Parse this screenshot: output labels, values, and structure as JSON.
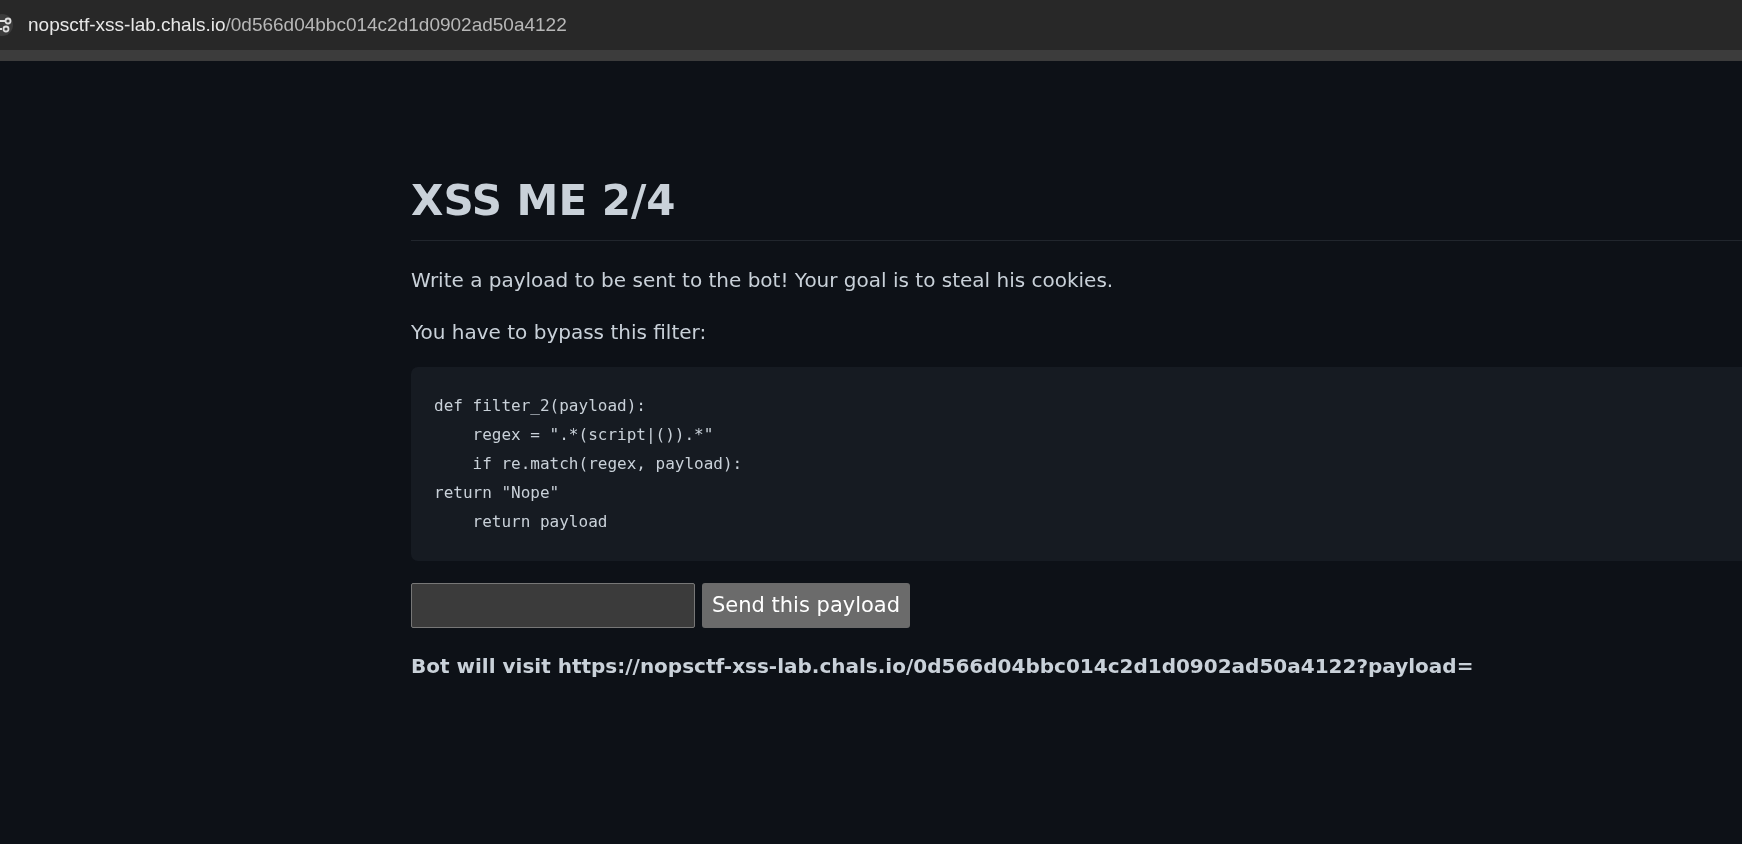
{
  "address_bar": {
    "domain": "nopsctf-xss-lab.chals.io",
    "path": "/0d566d04bbc014c2d1d0902ad50a4122"
  },
  "page": {
    "title": "XSS ME 2/4",
    "paragraphs": [
      "Write a payload to be sent to the bot! Your goal is to steal his cookies.",
      "You have to bypass this filter:"
    ],
    "code_lines": [
      "def filter_2(payload):",
      "    regex = \".*(script|()).*\"",
      "    if re.match(regex, payload):",
      "return \"Nope\"",
      "    return payload"
    ],
    "send_button": "Send this payload",
    "bot_note": "Bot will visit https://nopsctf-xss-lab.chals.io/0d566d04bbc014c2d1d0902ad50a4122?payload="
  }
}
